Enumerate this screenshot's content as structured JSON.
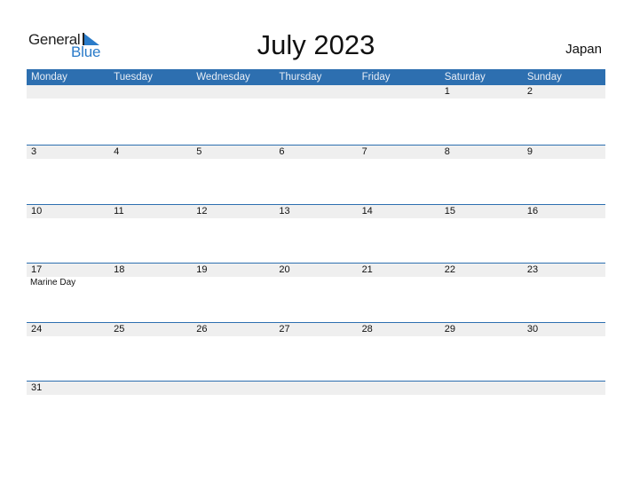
{
  "logo": {
    "word1": "General",
    "word2": "Blue"
  },
  "title": "July 2023",
  "country": "Japan",
  "colors": {
    "header": "#2d6fb0",
    "accent": "#2a7bc9",
    "daynum_bg": "#efefef"
  },
  "weekdays": [
    "Monday",
    "Tuesday",
    "Wednesday",
    "Thursday",
    "Friday",
    "Saturday",
    "Sunday"
  ],
  "weeks": [
    [
      {
        "d": ""
      },
      {
        "d": ""
      },
      {
        "d": ""
      },
      {
        "d": ""
      },
      {
        "d": ""
      },
      {
        "d": "1"
      },
      {
        "d": "2"
      }
    ],
    [
      {
        "d": "3"
      },
      {
        "d": "4"
      },
      {
        "d": "5"
      },
      {
        "d": "6"
      },
      {
        "d": "7"
      },
      {
        "d": "8"
      },
      {
        "d": "9"
      }
    ],
    [
      {
        "d": "10"
      },
      {
        "d": "11"
      },
      {
        "d": "12"
      },
      {
        "d": "13"
      },
      {
        "d": "14"
      },
      {
        "d": "15"
      },
      {
        "d": "16"
      }
    ],
    [
      {
        "d": "17",
        "e": "Marine Day"
      },
      {
        "d": "18"
      },
      {
        "d": "19"
      },
      {
        "d": "20"
      },
      {
        "d": "21"
      },
      {
        "d": "22"
      },
      {
        "d": "23"
      }
    ],
    [
      {
        "d": "24"
      },
      {
        "d": "25"
      },
      {
        "d": "26"
      },
      {
        "d": "27"
      },
      {
        "d": "28"
      },
      {
        "d": "29"
      },
      {
        "d": "30"
      }
    ],
    [
      {
        "d": "31"
      },
      {
        "d": ""
      },
      {
        "d": ""
      },
      {
        "d": ""
      },
      {
        "d": ""
      },
      {
        "d": ""
      },
      {
        "d": ""
      }
    ]
  ]
}
